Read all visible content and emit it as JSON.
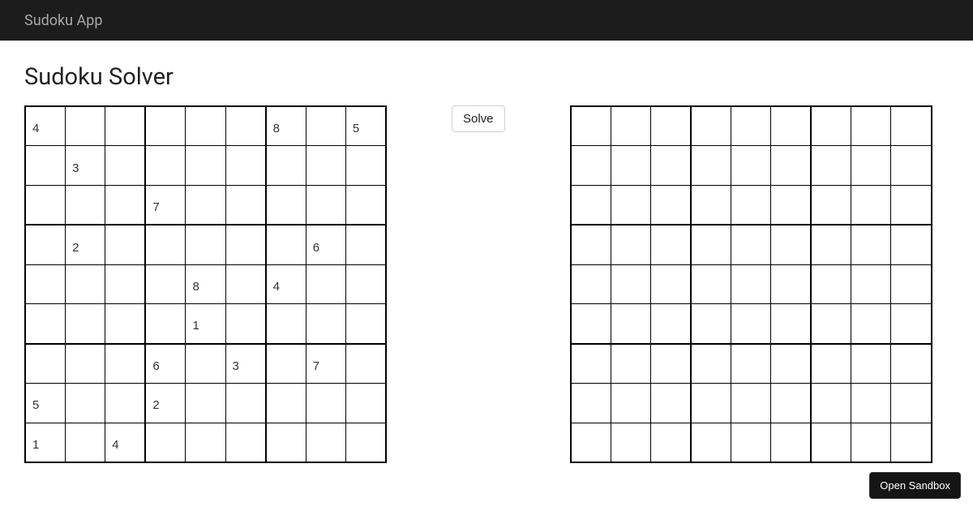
{
  "header": {
    "title": "Sudoku App"
  },
  "page": {
    "title": "Sudoku Solver"
  },
  "buttons": {
    "solve": "Solve",
    "open_sandbox": "Open Sandbox"
  },
  "input_board": [
    [
      "4",
      "",
      "",
      "",
      "",
      "",
      "8",
      "",
      "5"
    ],
    [
      "",
      "3",
      "",
      "",
      "",
      "",
      "",
      "",
      ""
    ],
    [
      "",
      "",
      "",
      "7",
      "",
      "",
      "",
      "",
      ""
    ],
    [
      "",
      "2",
      "",
      "",
      "",
      "",
      "",
      "6",
      ""
    ],
    [
      "",
      "",
      "",
      "",
      "8",
      "",
      "4",
      "",
      ""
    ],
    [
      "",
      "",
      "",
      "",
      "1",
      "",
      "",
      "",
      ""
    ],
    [
      "",
      "",
      "",
      "6",
      "",
      "3",
      "",
      "7",
      ""
    ],
    [
      "5",
      "",
      "",
      "2",
      "",
      "",
      "",
      "",
      ""
    ],
    [
      "1",
      "",
      "4",
      "",
      "",
      "",
      "",
      "",
      ""
    ]
  ],
  "output_board": [
    [
      "",
      "",
      "",
      "",
      "",
      "",
      "",
      "",
      ""
    ],
    [
      "",
      "",
      "",
      "",
      "",
      "",
      "",
      "",
      ""
    ],
    [
      "",
      "",
      "",
      "",
      "",
      "",
      "",
      "",
      ""
    ],
    [
      "",
      "",
      "",
      "",
      "",
      "",
      "",
      "",
      ""
    ],
    [
      "",
      "",
      "",
      "",
      "",
      "",
      "",
      "",
      ""
    ],
    [
      "",
      "",
      "",
      "",
      "",
      "",
      "",
      "",
      ""
    ],
    [
      "",
      "",
      "",
      "",
      "",
      "",
      "",
      "",
      ""
    ],
    [
      "",
      "",
      "",
      "",
      "",
      "",
      "",
      "",
      ""
    ],
    [
      "",
      "",
      "",
      "",
      "",
      "",
      "",
      "",
      ""
    ]
  ]
}
